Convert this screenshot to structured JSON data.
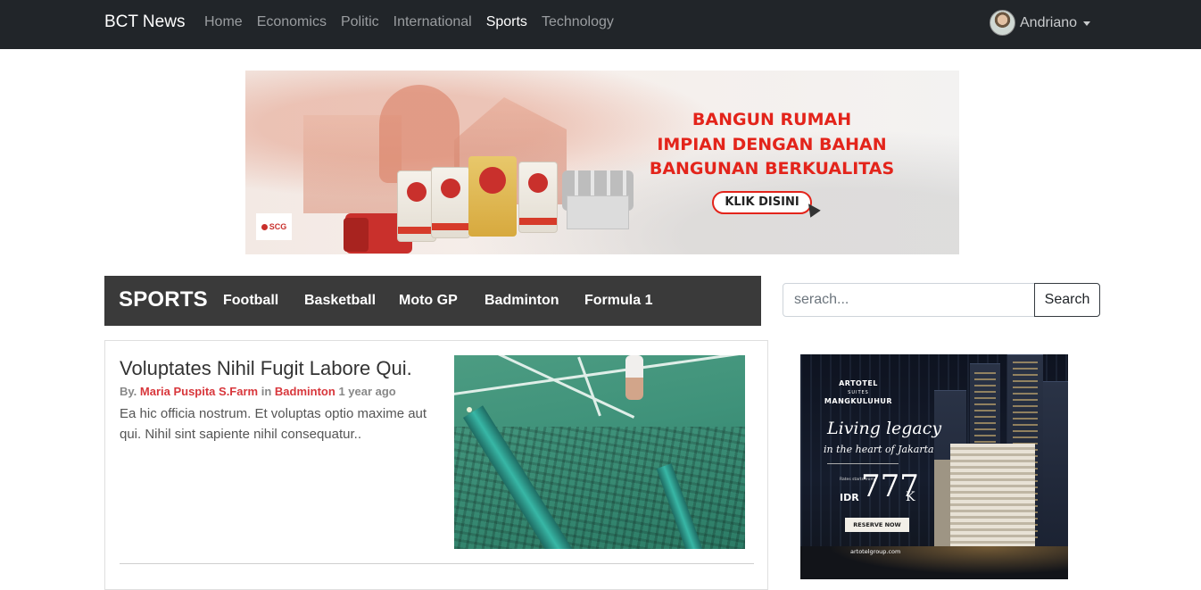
{
  "navbar": {
    "brand": "BCT News",
    "links": [
      "Home",
      "Economics",
      "Politic",
      "International",
      "Sports",
      "Technology"
    ],
    "active_link": "Sports",
    "user_name": "Andriano"
  },
  "banner_ad": {
    "headline_lines": [
      "BANGUN RUMAH",
      "IMPIAN DENGAN BAHAN",
      "BANGUNAN BERKUALITAS"
    ],
    "cta": "KLIK DISINI",
    "brand": "SCG",
    "bag_label": "SCG",
    "accent_color": "#e3241b"
  },
  "sports_bar": {
    "title": "SPORTS",
    "categories": [
      "Football",
      "Basketball",
      "Moto GP",
      "Badminton",
      "Formula 1"
    ]
  },
  "search": {
    "placeholder": "serach...",
    "button": "Search"
  },
  "article": {
    "title": "Voluptates Nihil Fugit Labore Qui.",
    "by_prefix": "By.",
    "author": "Maria Puspita S.Farm",
    "in_word": "in",
    "category": "Badminton",
    "time": "1 year ago",
    "excerpt": "Ea hic officia nostrum. Et voluptas optio maxime aut qui. Nihil sint sapiente nihil consequatur..",
    "link_color": "#d8373c"
  },
  "side_ad": {
    "brand": "ARTOTEL",
    "brand_sub": "SUITES",
    "location": "MANGKULUHUR",
    "script_title": "Living legacy",
    "script_sub": "in the heart of Jakarta",
    "fine_print": "Rates starts from",
    "currency": "IDR",
    "price": "777",
    "price_suffix": "K",
    "cta": "RESERVE NOW",
    "url": "artotelgroup.com"
  }
}
